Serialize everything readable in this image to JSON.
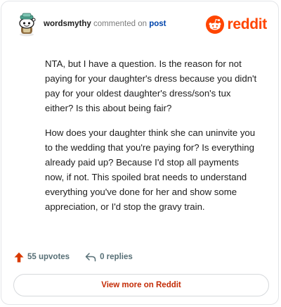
{
  "header": {
    "username": "wordsmythy",
    "action_text": "commented on",
    "post_link": "post",
    "brand_name": "reddit"
  },
  "comment": {
    "paragraphs": [
      "NTA, but I have a question. Is the reason for not paying for your daughter's dress because you didn't pay for your oldest daughter's dress/son's tux either? Is this about being fair?",
      "How does your daughter think she can uninvite you to the wedding that you're paying for? Is everything already paid up? Because I'd stop all payments now, if not. This spoiled brat needs to understand everything you've done for her and show some appreciation, or I'd stop the gravy train."
    ]
  },
  "footer": {
    "upvotes_label": "55 upvotes",
    "replies_label": "0 replies",
    "view_more_label": "View more on Reddit"
  },
  "icons": {
    "avatar": "snoo-avatar-icon",
    "brand": "reddit-snoo-icon",
    "upvote": "upvote-arrow-icon",
    "reply": "reply-arrow-icon"
  },
  "colors": {
    "brand_orange": "#ff4500",
    "upvote_orange": "#d93900",
    "link_blue": "#0045ac",
    "cta_text": "#c32b05",
    "muted_text": "#576f76"
  }
}
